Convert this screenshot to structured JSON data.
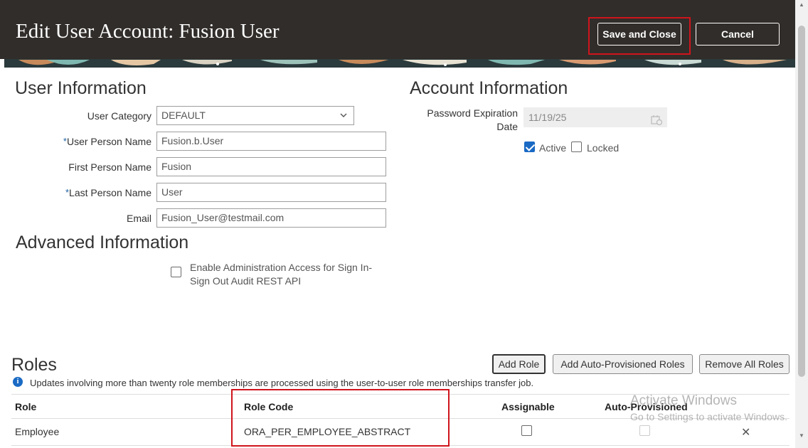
{
  "header": {
    "title": "Edit User Account: Fusion User",
    "save_close_label": "Save and Close",
    "cancel_label": "Cancel"
  },
  "user_info": {
    "title": "User Information",
    "user_category_label": "User Category",
    "user_category_value": "DEFAULT",
    "user_person_name_label": "User Person Name",
    "user_person_name_value": "Fusion.b.User",
    "first_person_name_label": "First Person Name",
    "first_person_name_value": "Fusion",
    "last_person_name_label": "Last Person Name",
    "last_person_name_value": "User",
    "email_label": "Email",
    "email_value": "Fusion_User@testmail.com",
    "required_marker": "*"
  },
  "account_info": {
    "title": "Account Information",
    "password_expiration_label_1": "Password Expiration",
    "password_expiration_label_2": "Date",
    "password_expiration_value": "11/19/25",
    "active_label": "Active",
    "active_checked": true,
    "locked_label": "Locked",
    "locked_checked": false
  },
  "advanced_info": {
    "title": "Advanced Information",
    "admin_access_label_1": "Enable Administration Access for Sign In-",
    "admin_access_label_2": "Sign Out Audit REST API",
    "admin_access_checked": false
  },
  "roles": {
    "title": "Roles",
    "add_role_label": "Add Role",
    "add_auto_provisioned_label": "Add Auto-Provisioned Roles",
    "remove_all_label": "Remove All Roles",
    "info_message": "Updates involving more than twenty role memberships are processed using the user-to-user role memberships transfer job.",
    "columns": [
      "Role",
      "Role Code",
      "Assignable",
      "Auto-Provisioned"
    ],
    "rows": [
      {
        "role": "Employee",
        "role_code": "ORA_PER_EMPLOYEE_ABSTRACT",
        "assignable": false,
        "auto_provisioned": false
      }
    ]
  },
  "watermark": {
    "line1": "Activate Windows",
    "line2": "Go to Settings to activate Windows."
  },
  "colors": {
    "header_bg": "#312d2a",
    "highlight": "#d0141c",
    "checkbox_checked": "#1a6ac4"
  }
}
